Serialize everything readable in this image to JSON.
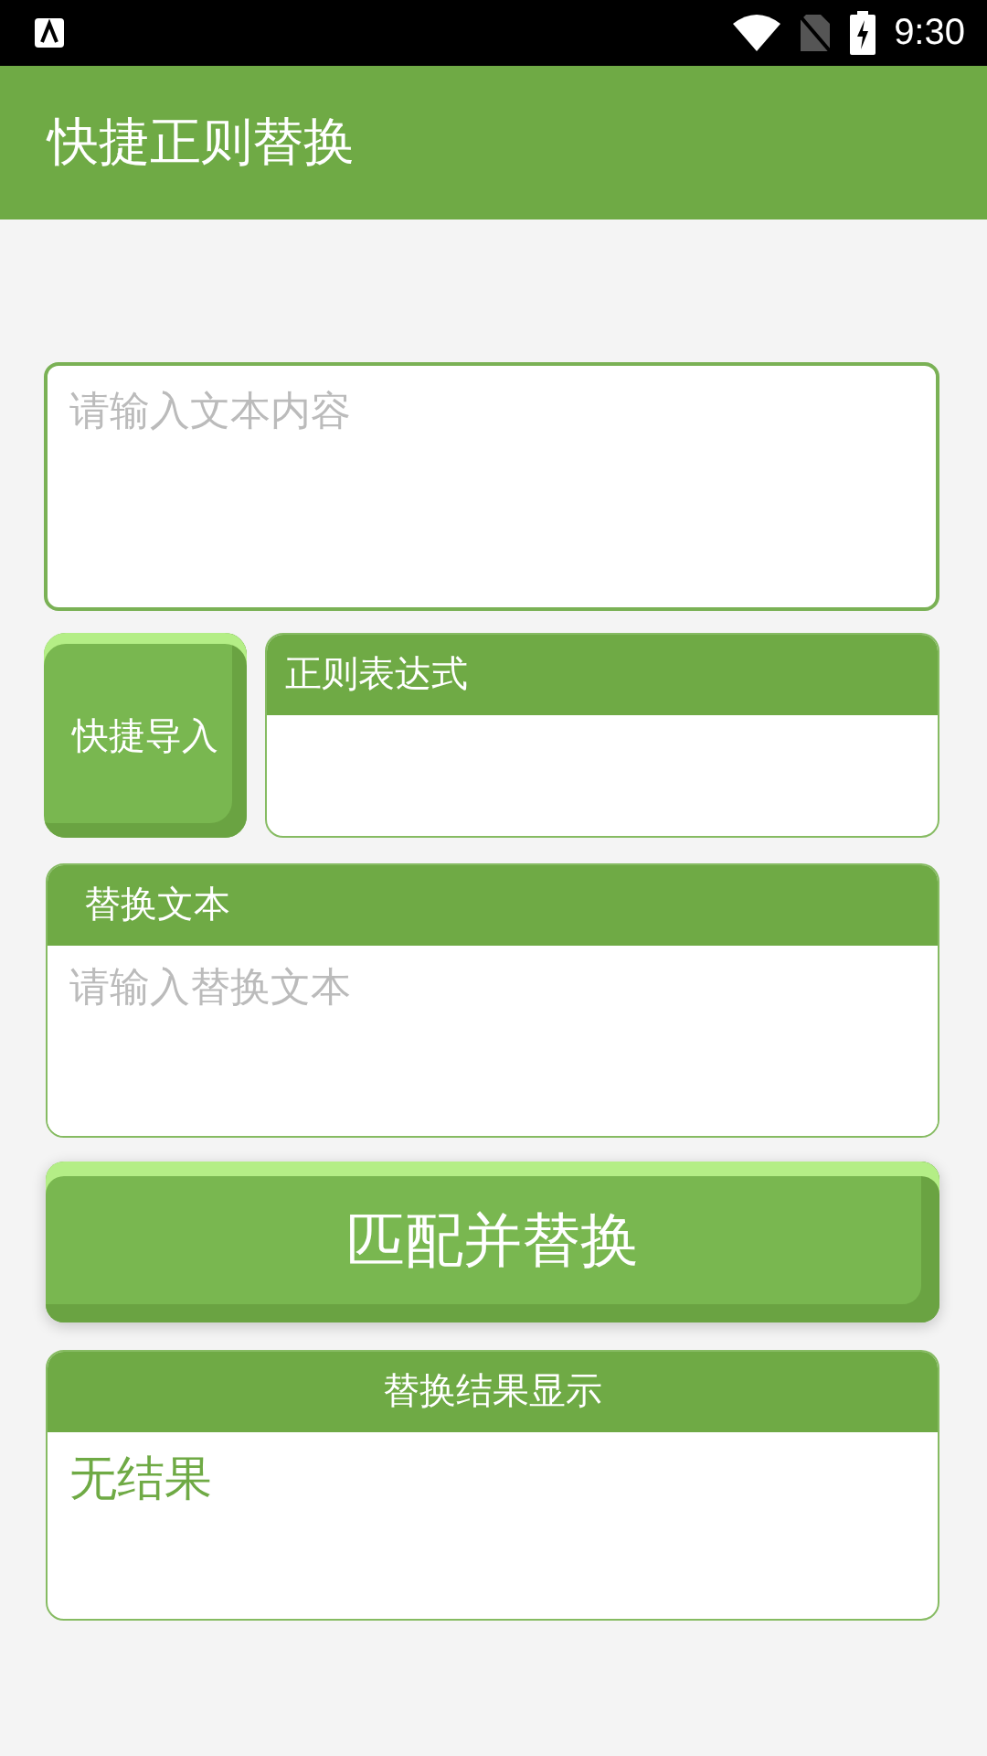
{
  "status_bar": {
    "time": "9:30"
  },
  "app_bar": {
    "title": "快捷正则替换"
  },
  "text_input": {
    "placeholder": "请输入文本内容"
  },
  "import_button": {
    "label": "快捷导入"
  },
  "regex_card": {
    "header": "正则表达式"
  },
  "replace_card": {
    "header": "替换文本",
    "placeholder": "请输入替换文本"
  },
  "match_button": {
    "label": "匹配并替换"
  },
  "result_card": {
    "header": "替换结果显示",
    "value": "无结果"
  }
}
